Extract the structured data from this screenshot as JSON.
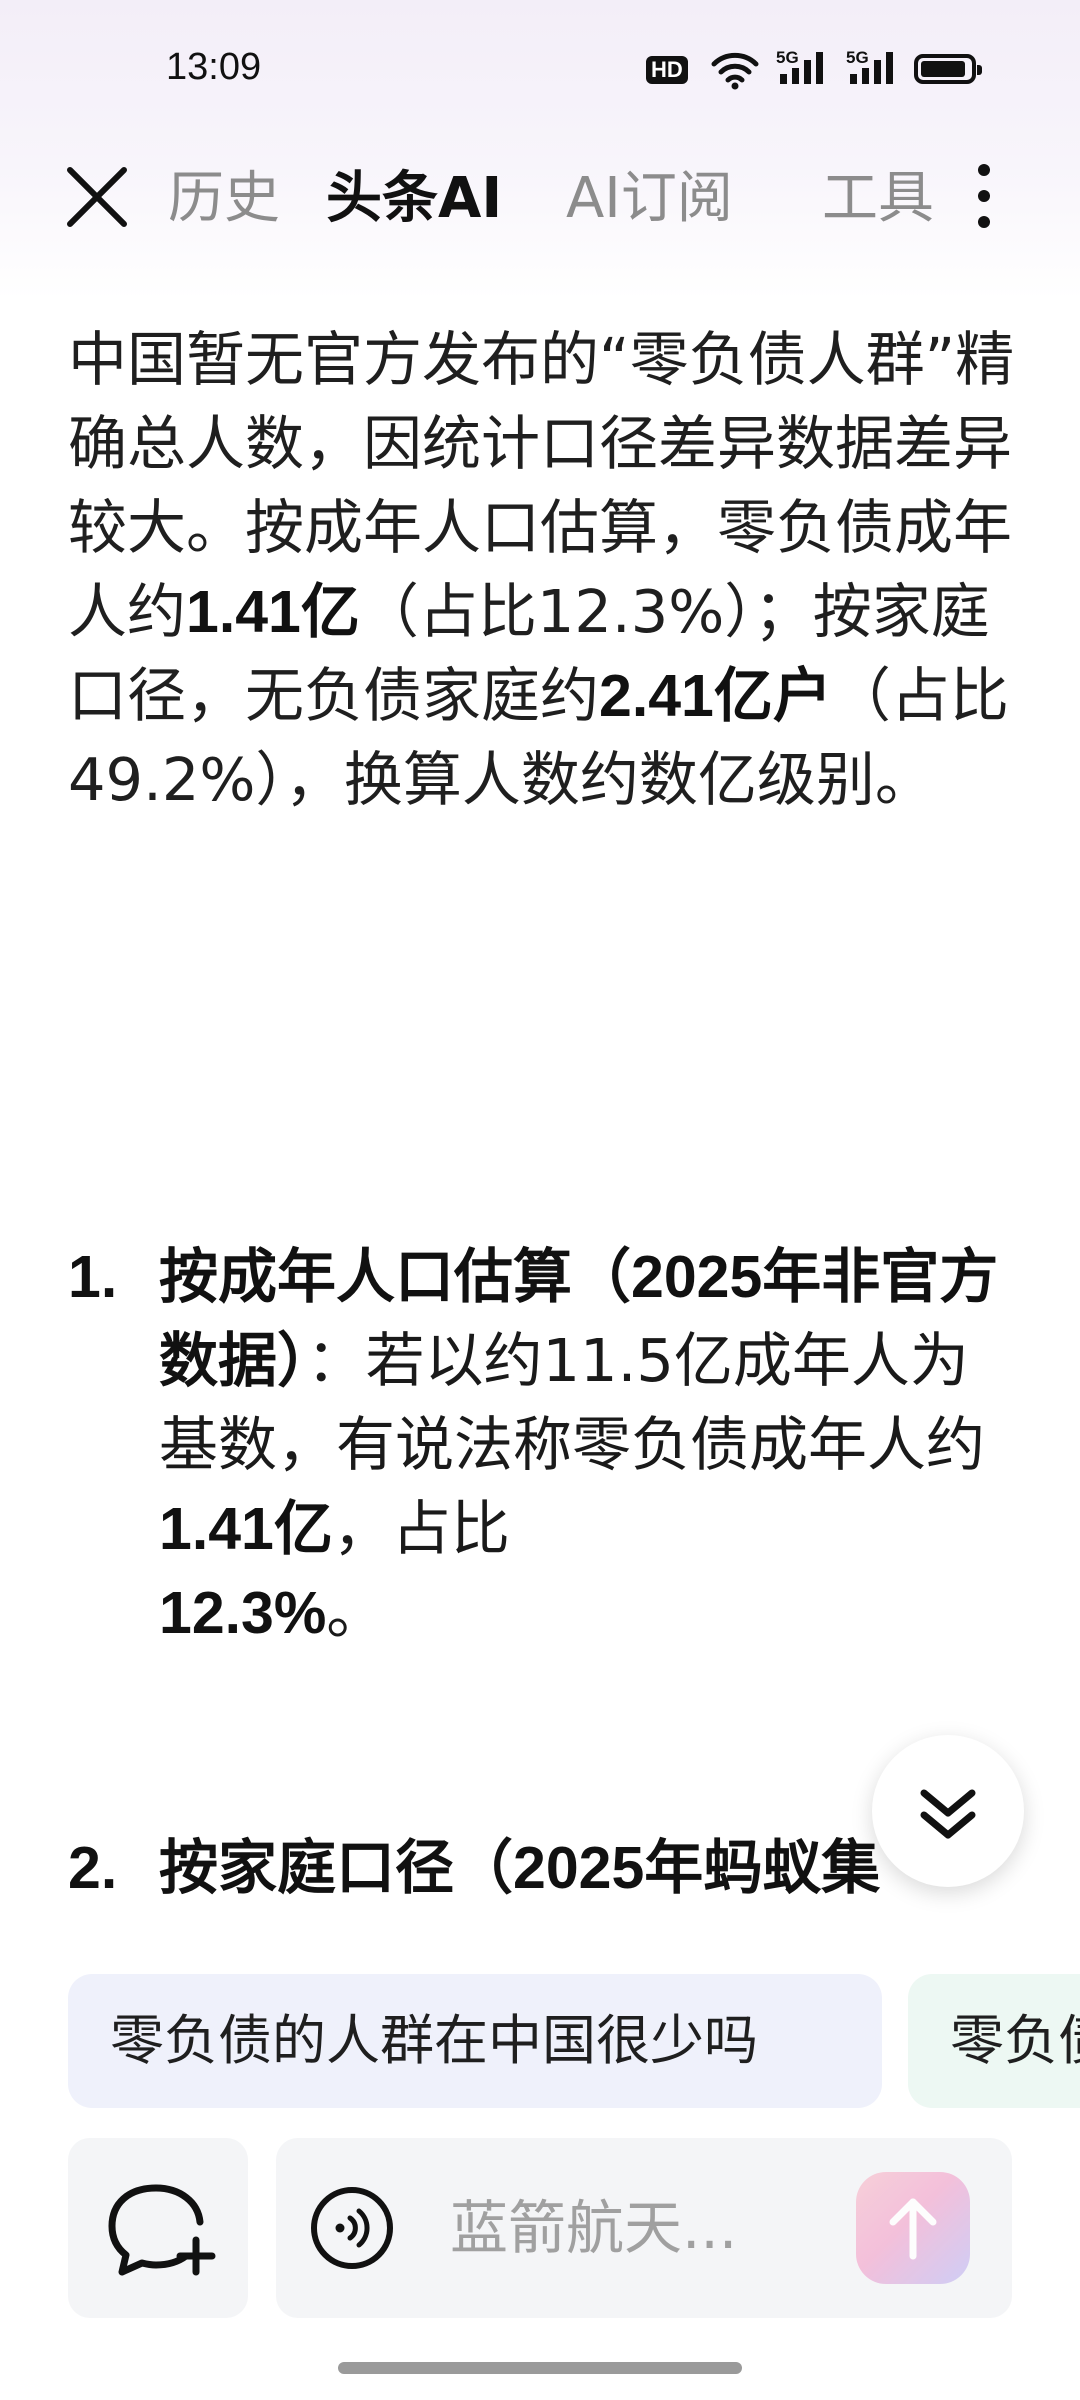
{
  "status_bar": {
    "time": "13:09",
    "hd_label": "HD",
    "network_1": "5G",
    "network_2": "5G",
    "battery_level": 0.85
  },
  "nav": {
    "tabs": [
      {
        "label": "历史",
        "active": false
      },
      {
        "label": "头条AI",
        "active": true
      },
      {
        "label": "AI订阅",
        "active": false
      },
      {
        "label": "工具",
        "active": false
      }
    ]
  },
  "answer": {
    "intro_1": "中国暂无官方发布的“零负债人群”精确总人数，因统计口径差异数据差异较大。按成年人口估算，零负债成年人约",
    "intro_2": "1.41亿",
    "intro_3": "（占比12.3%）；按家庭口径，无负债家庭约",
    "intro_4": "2.41亿户",
    "intro_5": "（占比49.2%），换算人数约数亿级别。",
    "items": [
      {
        "number": "1.",
        "title": "按成年人口估算（2025年非官方数据）",
        "text_1": "：若以约11.5亿成年人为基数，有说法称零负债成年人约",
        "highlight_1": "1.41亿",
        "text_2": "，占比",
        "highlight_2": "12.3%",
        "text_3": "。"
      },
      {
        "number": "2.",
        "title": "按家庭口径（2025年蚂蚁集"
      }
    ]
  },
  "suggestions": [
    "零负债的人群在中国很少吗",
    "零负债"
  ],
  "composer": {
    "placeholder": "蓝箭航天..."
  },
  "colors": {
    "accent_gradient_start": "#f8c9d3",
    "accent_gradient_end": "#c9c7f6",
    "chip_1_bg": "#eff1fb",
    "chip_2_bg": "#edf8f3"
  }
}
